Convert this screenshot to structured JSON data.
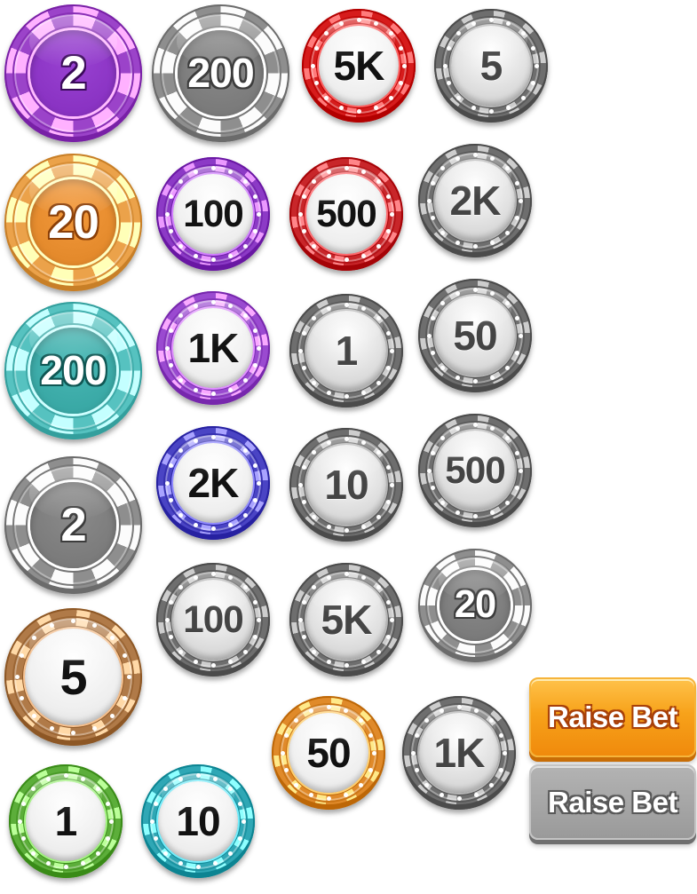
{
  "chips": [
    {
      "name": "chip-flat-purple-2",
      "label": "2",
      "style": "flat",
      "ring": "#9b43c9",
      "face": "#8a33c3",
      "text": "#ffffff",
      "outline": "#3a0a5a"
    },
    {
      "name": "chip-flat-gray-200",
      "label": "200",
      "style": "flat",
      "ring": "#8e8e8e",
      "face": "#7b7b7b",
      "text": "#ffffff",
      "outline": "#3c3c3c"
    },
    {
      "name": "chip-red-5k",
      "label": "5K",
      "style": "glossy",
      "ring": "#d61c1c",
      "face": "#eeeeee",
      "text": "#111111"
    },
    {
      "name": "chip-gray-5",
      "label": "5",
      "style": "glossy",
      "ring": "#6e6e6e",
      "face": "#dcdcdc",
      "text": "#444444"
    },
    {
      "name": "chip-flat-orange-20",
      "label": "20",
      "style": "flat",
      "ring": "#eba24a",
      "face": "#e48a2c",
      "text": "#ffffff",
      "outline": "#8a3f08"
    },
    {
      "name": "chip-purple-100",
      "label": "100",
      "style": "glossy",
      "ring": "#8c3ac6",
      "face": "#eeeeee",
      "text": "#111111"
    },
    {
      "name": "chip-red-500",
      "label": "500",
      "style": "glossy",
      "ring": "#c8262a",
      "face": "#eeeeee",
      "text": "#111111"
    },
    {
      "name": "chip-gray-2k",
      "label": "2K",
      "style": "glossy",
      "ring": "#6e6e6e",
      "face": "#dcdcdc",
      "text": "#444444"
    },
    {
      "name": "chip-flat-teal-200",
      "label": "200",
      "style": "flat",
      "ring": "#56c2c0",
      "face": "#3aa9a6",
      "text": "#ffffff",
      "outline": "#0f5653"
    },
    {
      "name": "chip-purple-1k",
      "label": "1K",
      "style": "glossy",
      "ring": "#9a4ad0",
      "face": "#eeeeee",
      "text": "#111111"
    },
    {
      "name": "chip-gray-1",
      "label": "1",
      "style": "glossy",
      "ring": "#6e6e6e",
      "face": "#dcdcdc",
      "text": "#444444"
    },
    {
      "name": "chip-gray-50",
      "label": "50",
      "style": "glossy",
      "ring": "#6e6e6e",
      "face": "#dcdcdc",
      "text": "#444444"
    },
    {
      "name": "chip-flat-gray-2",
      "label": "2",
      "style": "flat",
      "ring": "#8e8e8e",
      "face": "#7b7b7b",
      "text": "#ffffff",
      "outline": "#3c3c3c"
    },
    {
      "name": "chip-blue-2k",
      "label": "2K",
      "style": "glossy",
      "ring": "#4a44c4",
      "face": "#eeeeee",
      "text": "#111111"
    },
    {
      "name": "chip-gray-10",
      "label": "10",
      "style": "glossy",
      "ring": "#6e6e6e",
      "face": "#dcdcdc",
      "text": "#444444"
    },
    {
      "name": "chip-gray-500",
      "label": "500",
      "style": "glossy",
      "ring": "#6e6e6e",
      "face": "#dcdcdc",
      "text": "#444444"
    },
    {
      "name": "chip-brown-5",
      "label": "5",
      "style": "glossy",
      "ring": "#b07a48",
      "face": "#eeeeee",
      "text": "#111111"
    },
    {
      "name": "chip-gray-100",
      "label": "100",
      "style": "glossy",
      "ring": "#6e6e6e",
      "face": "#dcdcdc",
      "text": "#444444"
    },
    {
      "name": "chip-gray-5k",
      "label": "5K",
      "style": "glossy",
      "ring": "#6e6e6e",
      "face": "#dcdcdc",
      "text": "#444444"
    },
    {
      "name": "chip-flat-gray-20",
      "label": "20",
      "style": "flat",
      "ring": "#8e8e8e",
      "face": "#7b7b7b",
      "text": "#ffffff",
      "outline": "#3c3c3c"
    },
    {
      "name": "chip-orange-50",
      "label": "50",
      "style": "glossy",
      "ring": "#e08a2a",
      "face": "#eeeeee",
      "text": "#111111"
    },
    {
      "name": "chip-gray-1k",
      "label": "1K",
      "style": "glossy",
      "ring": "#6e6e6e",
      "face": "#dcdcdc",
      "text": "#444444"
    },
    {
      "name": "chip-green-1",
      "label": "1",
      "style": "glossy",
      "ring": "#5cae3a",
      "face": "#eeeeee",
      "text": "#111111"
    },
    {
      "name": "chip-teal-10",
      "label": "10",
      "style": "glossy",
      "ring": "#2fa7b5",
      "face": "#eeeeee",
      "text": "#111111"
    }
  ],
  "buttons": {
    "raise_bet_label": "Raise Bet",
    "raise_bet_disabled_label": "Raise Bet",
    "active_color": "#f7a21a",
    "disabled_color": "#a5a5a5"
  }
}
